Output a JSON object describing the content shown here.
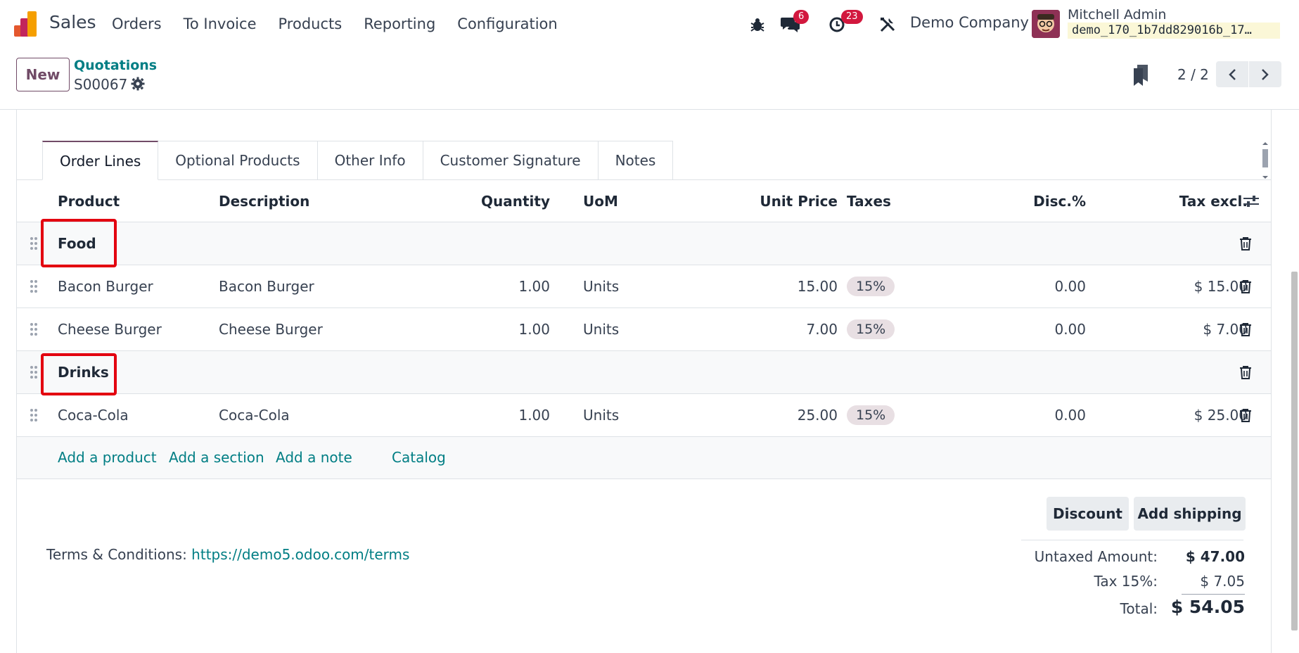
{
  "navbar": {
    "app_name": "Sales",
    "menu": [
      "Orders",
      "To Invoice",
      "Products",
      "Reporting",
      "Configuration"
    ],
    "messages_count": "6",
    "activities_count": "23",
    "company": "Demo Company",
    "user_name": "Mitchell Admin",
    "database": "demo_170_1b7dd829016b_17…"
  },
  "control": {
    "new_label": "New",
    "breadcrumb": "Quotations",
    "record_name": "S00067",
    "pager": "2 / 2"
  },
  "tabs": [
    "Order Lines",
    "Optional Products",
    "Other Info",
    "Customer Signature",
    "Notes"
  ],
  "table": {
    "headers": {
      "product": "Product",
      "description": "Description",
      "quantity": "Quantity",
      "uom": "UoM",
      "unit_price": "Unit Price",
      "taxes": "Taxes",
      "discount": "Disc.%",
      "tax_excl": "Tax excl."
    },
    "sections": [
      "Food",
      "Drinks"
    ],
    "lines": [
      {
        "product": "Bacon Burger",
        "description": "Bacon Burger",
        "quantity": "1.00",
        "uom": "Units",
        "unit_price": "15.00",
        "tax": "15%",
        "discount": "0.00",
        "subtotal": "$ 15.00"
      },
      {
        "product": "Cheese Burger",
        "description": "Cheese Burger",
        "quantity": "1.00",
        "uom": "Units",
        "unit_price": "7.00",
        "tax": "15%",
        "discount": "0.00",
        "subtotal": "$ 7.00"
      },
      {
        "product": "Coca-Cola",
        "description": "Coca-Cola",
        "quantity": "1.00",
        "uom": "Units",
        "unit_price": "25.00",
        "tax": "15%",
        "discount": "0.00",
        "subtotal": "$ 25.00"
      }
    ],
    "add_links": {
      "product": "Add a product",
      "section": "Add a section",
      "note": "Add a note",
      "catalog": "Catalog"
    }
  },
  "footer": {
    "discount_button": "Discount",
    "shipping_button": "Add shipping",
    "terms_label": "Terms & Conditions:",
    "terms_link": "https://demo5.odoo.com/terms"
  },
  "totals": {
    "untaxed_label": "Untaxed Amount:",
    "untaxed_value": "$ 47.00",
    "tax_label": "Tax 15%:",
    "tax_value": "$ 7.05",
    "total_label": "Total:",
    "total_value": "$ 54.05"
  },
  "colors": {
    "brand": "#714b67",
    "link": "#017e84",
    "badge": "#d2183e",
    "highlight": "#e3000f"
  }
}
